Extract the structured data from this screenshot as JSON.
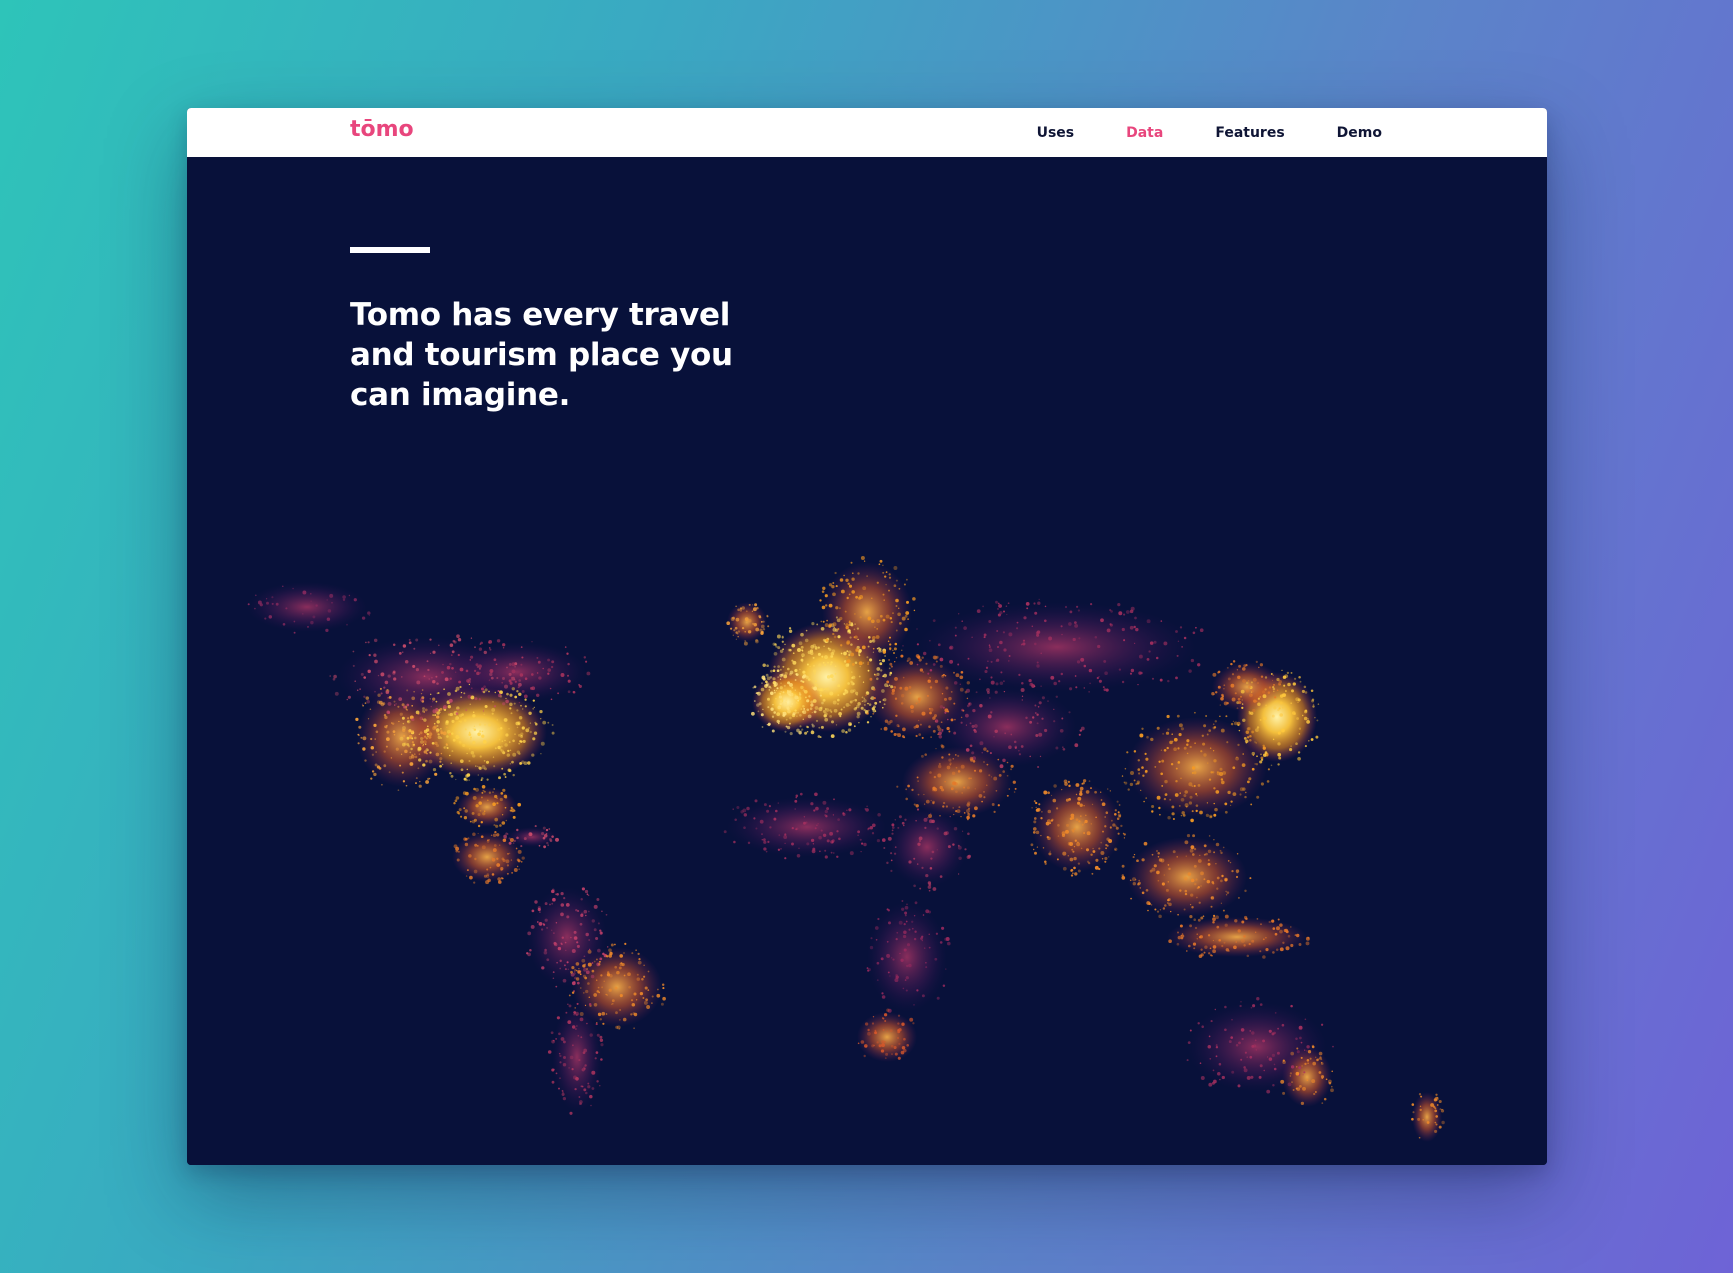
{
  "nav": {
    "logo": "tōmo",
    "links": [
      {
        "label": "Uses",
        "active": false
      },
      {
        "label": "Data",
        "active": true
      },
      {
        "label": "Features",
        "active": false
      },
      {
        "label": "Demo",
        "active": false
      }
    ]
  },
  "hero": {
    "headline": "Tomo has every travel and tourism place you can imagine."
  },
  "colors": {
    "brand": "#e8467d",
    "background": "#08113a",
    "nav_text": "#0f1535",
    "glow_hot": "#ffd95a",
    "glow_mid": "#f59a23",
    "glow_cool": "#b0306a"
  },
  "map": {
    "description_icon": "world-map-night-lights"
  }
}
